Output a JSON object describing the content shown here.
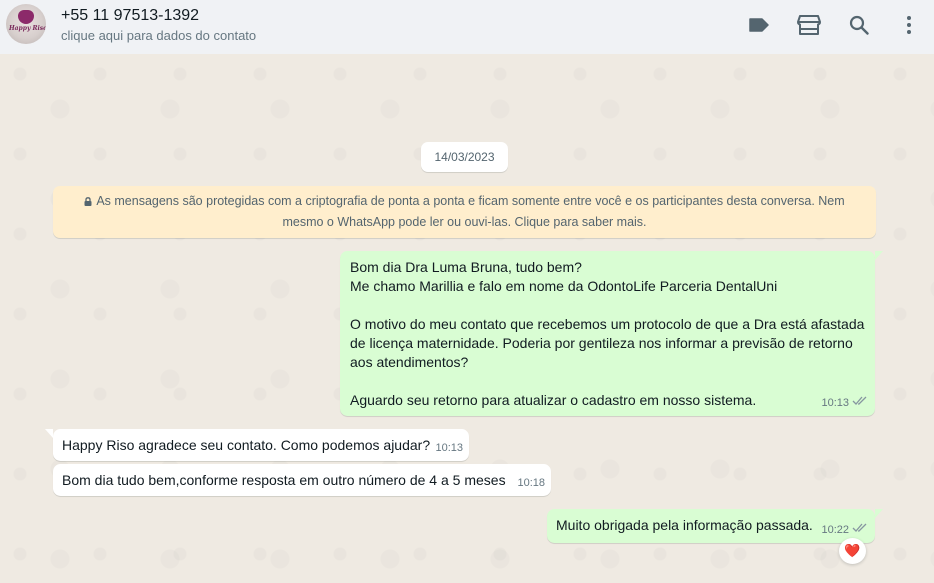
{
  "header": {
    "contact_name": "+55 11 97513-1392",
    "contact_subtitle": "clique aqui para dados do contato",
    "avatar_logo_text": "Happy Riso",
    "icons": [
      "label-icon",
      "store-icon",
      "search-icon",
      "menu-icon"
    ]
  },
  "chat": {
    "date": "14/03/2023",
    "encryption_notice": "As mensagens são protegidas com a criptografia de ponta a ponta e ficam somente entre você e os participantes desta conversa. Nem mesmo o WhatsApp pode ler ou ouvi-las. Clique para saber mais.",
    "messages": [
      {
        "direction": "out",
        "text": "Bom dia Dra Luma Bruna, tudo bem?\nMe chamo Marillia e falo em nome da OdontoLife Parceria DentalUni\n\nO motivo do meu contato que recebemos um protocolo de que a Dra está afastada de licença maternidade. Poderia por gentileza nos informar a previsão de retorno aos atendimentos?\n\nAguardo seu retorno para atualizar o cadastro em nosso sistema.",
        "time": "10:13",
        "status": "read"
      },
      {
        "direction": "in",
        "text": "Happy Riso agradece seu contato. Como podemos ajudar?",
        "time": "10:13"
      },
      {
        "direction": "in",
        "text": "Bom dia tudo bem,conforme resposta em outro número de 4 a 5 meses",
        "time": "10:18"
      },
      {
        "direction": "out",
        "text": "Muito obrigada pela informação passada.",
        "time": "10:22",
        "status": "read",
        "reaction": "❤️"
      }
    ]
  },
  "colors": {
    "outgoing_bubble": "#d9fdd3",
    "incoming_bubble": "#ffffff",
    "chat_background": "#efeae2",
    "header_background": "#f0f2f5",
    "read_ticks": "#8696a0"
  }
}
